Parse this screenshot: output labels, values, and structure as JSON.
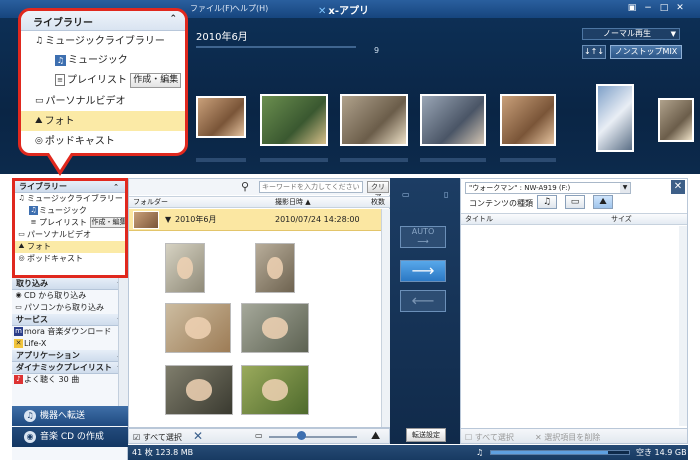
{
  "window": {
    "title": "x-アプリ",
    "menu": [
      "ファイル(F)",
      "ヘルプ(H)"
    ],
    "buttons": [
      "▣",
      "−",
      "□",
      "✕"
    ]
  },
  "banner": {
    "now_title": "2010年6月",
    "now_count": "9",
    "mode": "ノーマル再生",
    "shuffle": "↓↑↓",
    "nonstop": "ノンストップMIX"
  },
  "callout": {
    "header": "ライブラリー",
    "items": [
      {
        "label": "ミュージックライブラリー",
        "icon": "music-note-icon"
      },
      {
        "label": "ミュージック",
        "icon": "music-note-icon"
      },
      {
        "label": "プレイリスト",
        "icon": "playlist-icon",
        "button": "作成・編集"
      },
      {
        "label": "パーソナルビデオ",
        "icon": "film-icon"
      },
      {
        "label": "フォト",
        "icon": "photo-icon",
        "selected": true
      },
      {
        "label": "ポッドキャスト",
        "icon": "podcast-icon"
      }
    ]
  },
  "sidebar": {
    "library_header": "ライブラリー",
    "library_items": [
      {
        "label": "ミュージックライブラリー"
      },
      {
        "label": "ミュージック"
      },
      {
        "label": "プレイリスト",
        "button": "作成・編集"
      },
      {
        "label": "パーソナルビデオ"
      },
      {
        "label": "フォト",
        "selected": true
      },
      {
        "label": "ポッドキャスト"
      }
    ],
    "import_header": "取り込み",
    "import_items": [
      "CD から取り込み",
      "パソコンから取り込み"
    ],
    "service_header": "サービス",
    "service_items": [
      "mora 音楽ダウンロード",
      "Life-X"
    ],
    "app_header": "アプリケーション",
    "dynamic_header": "ダイナミックプレイリスト",
    "dynamic_items": [
      "よく聴く 30 曲"
    ],
    "transfer_device": "機器へ転送",
    "create_cd": "音楽 CD の作成"
  },
  "middle": {
    "search_placeholder": "キーワードを入力してください",
    "clear": "クリア",
    "col_folder": "フォルダー",
    "col_date": "撮影日時 ▲",
    "col_count": "枚数",
    "group_name": "2010年6月",
    "group_date": "2010/07/24 14:28:00",
    "select_all": "すべて選択"
  },
  "transfer": {
    "auto": "AUTO",
    "right": "⟶",
    "left": "⟵",
    "settings": "転送設定"
  },
  "right": {
    "device": "\"ウォークマン\" : NW-A919 (F:)",
    "content_type": "コンテンツの種類",
    "col_title": "タイトル",
    "col_size": "サイズ",
    "select_all": "すべて選択",
    "delete_selected": "選択項目を削除"
  },
  "status": {
    "summary": "41 枚 123.8 MB",
    "free": "空き 14.9 GB",
    "free_fraction": 0.85
  }
}
